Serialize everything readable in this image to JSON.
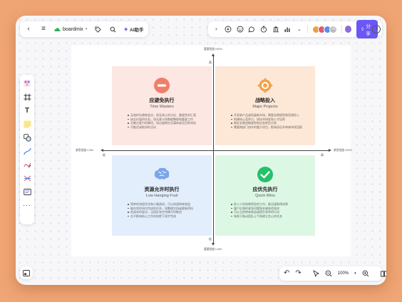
{
  "toolbar": {
    "brand": "boardmix",
    "ai_label": "AI助手",
    "share_label": "分享",
    "help": "?",
    "more_count": "+5"
  },
  "matrix": {
    "axis": {
      "top": "重要程度 HIGH",
      "bottom": "重要程度 LOW",
      "left": "紧急程度 LOW",
      "right": "紧急程度 HIGH",
      "tick_top": "高",
      "tick_bottom": "低",
      "tick_left": "低",
      "tick_right": "高"
    },
    "quadrants": [
      {
        "id": "tl",
        "title": "应避免执行",
        "subtitle": "Time Wasters",
        "icon": "minus-circle-icon",
        "color": "#f07f6a",
        "items": [
          "无效的沟通和会议，如无休止的讨论、重复性的汇报",
          "缺乏价值的任务，如无意义的数据整理和重复工作",
          "分散注意力的事项，如过度刷社交媒体或无目的浏览",
          "可推迟或取消的活动"
        ]
      },
      {
        "id": "tr",
        "title": "战略投入",
        "subtitle": "Major Projects",
        "icon": "target-icon",
        "color": "#f2a24a",
        "items": [
          "开发新产品或拓展新市场，需要长期规划和资源投入",
          "构建核心竞争力，如技术研发和人才培养",
          "制定长期战略规划和业务转型方案",
          "需要跨部门协作的重大项目，影响深远并带来持续回报"
        ]
      },
      {
        "id": "bl",
        "title": "资源允许时执行",
        "subtitle": "Low Hanging Fruit",
        "icon": "brain-icon",
        "color": "#7aa6ea",
        "items": [
          "简单的流程优化和小幅改进，可以快速带来收益",
          "能在短时间内完成的任务，如整理文档或更新资料",
          "低成本的尝试，当团队有空余精力时推进",
          "在不影响核心工作的前提下逐步完成"
        ]
      },
      {
        "id": "br",
        "title": "应优先执行",
        "subtitle": "Quick Wins",
        "icon": "check-circle-icon",
        "color": "#25c06a",
        "items": [
          "投入少但效果明显的工作，能迅速取得成果",
          "客户反馈的紧急问题和关键体验改进",
          "可以立即带来收益或提升效率的行动",
          "有助于推动团队士气和建立信心的任务"
        ]
      }
    ]
  },
  "zoom": {
    "value": "100%"
  }
}
